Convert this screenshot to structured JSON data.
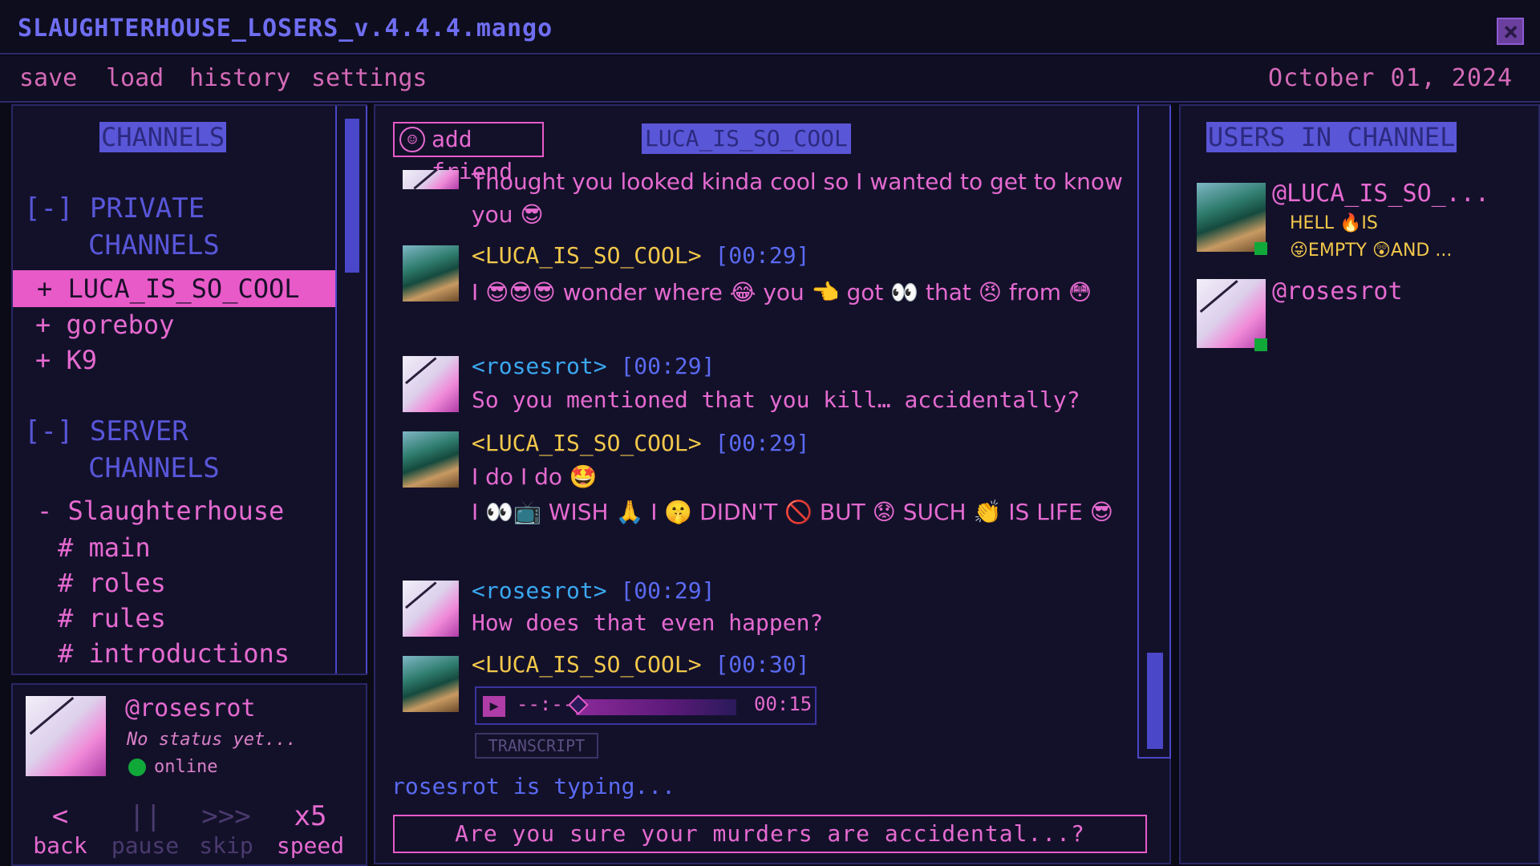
{
  "window": {
    "title": "SLAUGHTERHOUSE_LOSERS_v.4.4.4.mango"
  },
  "menu": {
    "save": "save",
    "load": "load",
    "history": "history",
    "settings": "settings",
    "date": "October 01, 2024"
  },
  "channels": {
    "header": "CHANNELS",
    "private_label_1": "[-] PRIVATE",
    "private_label_2": "CHANNELS",
    "private_items": [
      "+ LUCA_IS_SO_COOL",
      "+ goreboy",
      "+ K9"
    ],
    "server_label_1": "[-] SERVER",
    "server_label_2": "CHANNELS",
    "server_name": "- Slaughterhouse",
    "server_items": [
      "# main",
      "# roles",
      "# rules",
      "# introductions"
    ]
  },
  "profile": {
    "name": "@rosesrot",
    "status": "No status yet...",
    "online": "online"
  },
  "controls": {
    "back_icon": "<",
    "back": "back",
    "pause_icon": "||",
    "pause": "pause",
    "skip_icon": ">>>",
    "skip": "skip",
    "speed_icon": "x5",
    "speed": "speed"
  },
  "chat": {
    "add_friend": "add friend",
    "title": "LUCA_IS_SO_COOL",
    "messages": [
      {
        "text": "Thought you looked kinda cool so I wanted to get to know you 😎"
      },
      {
        "user": "<LUCA_IS_SO_COOL>",
        "time": "[00:29]",
        "text": "I 😎😎😎 wonder where 😂 you 👈 got 👀 that 😠 from 😳"
      },
      {
        "user": "<rosesrot>",
        "time": "[00:29]",
        "text": "So you mentioned that you kill… accidentally?"
      },
      {
        "user": "<LUCA_IS_SO_COOL>",
        "time": "[00:29]",
        "text": "I do I do 🤩",
        "text2": "I 👀📺 WISH 🙏 I 🤫 DIDN'T 🚫 BUT 😟 SUCH 👏 IS LIFE 😎"
      },
      {
        "user": "<rosesrot>",
        "time": "[00:29]",
        "text": "How does that even happen?"
      },
      {
        "user": "<LUCA_IS_SO_COOL>",
        "time": "[00:30]"
      }
    ],
    "audio": {
      "current": "--:--",
      "duration": "00:15",
      "progress": 0.0
    },
    "transcript": "TRANSCRIPT",
    "typing": "rosesrot is typing...",
    "input": "Are you sure your murders are accidental...?"
  },
  "users": {
    "header": "USERS IN CHANNEL",
    "list": [
      {
        "name": "@LUCA_IS_SO_...",
        "status1": "HELL 🔥IS",
        "status2": "😜EMPTY 😲AND ..."
      },
      {
        "name": "@rosesrot"
      }
    ]
  },
  "colors": {
    "accent_pink": "#e85ac8",
    "accent_blue": "#5a56d8",
    "luca": "#f2c84a",
    "rose": "#3aa8f0",
    "online": "#11a83a"
  }
}
